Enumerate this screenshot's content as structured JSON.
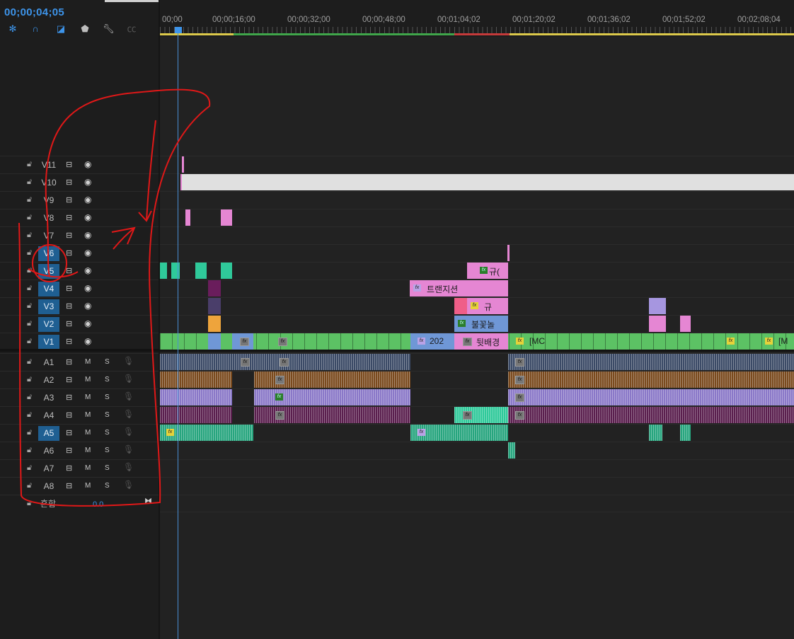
{
  "timecode": "00;00;04;05",
  "ruler": {
    "labels": [
      "00;00",
      "00;00;16;00",
      "00;00;32;00",
      "00;00;48;00",
      "00;01;04;02",
      "00;01;20;02",
      "00;01;36;02",
      "00;01;52;02",
      "00;02;08;04"
    ]
  },
  "tracks": {
    "video": [
      "V11",
      "V10",
      "V9",
      "V8",
      "V7",
      "V6",
      "V5",
      "V4",
      "V3",
      "V2",
      "V1"
    ],
    "audio": [
      "A1",
      "A2",
      "A3",
      "A4",
      "A5",
      "A6",
      "A7",
      "A8"
    ],
    "selected": [
      "V6",
      "V5",
      "V4",
      "V3",
      "V2",
      "V1",
      "A5"
    ],
    "m_label": "M",
    "s_label": "S"
  },
  "mix": {
    "label": "혼합",
    "value": "0.0"
  },
  "clips": {
    "v5_label": "규(",
    "v4_label": "트랜지션",
    "v3_label": "규",
    "v2_label": "불꽃놀",
    "v1_label_a": "202",
    "v1_label_b": "뒷배경",
    "v1_label_c": "[MC",
    "v1_label_d": "[M",
    "fx": "fx"
  },
  "colors": {
    "accent": "#3d94ea",
    "pink": "#e586d3",
    "teal": "#2fc99a",
    "green": "#5cc264",
    "blue_clip": "#6f97d6",
    "lavender": "#a696e0",
    "work_area": "#dcc94a",
    "annotation": "#e01818"
  }
}
